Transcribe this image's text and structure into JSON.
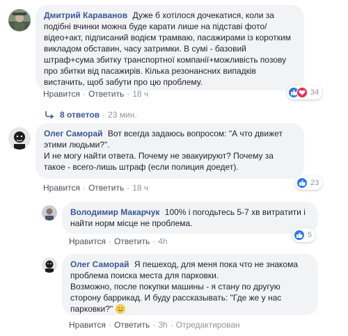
{
  "comments": [
    {
      "author": "Дмитрий Караванов",
      "text": "Дуже б хотілося дочекатися, коли за подібні вчинки можна буде карати лише на підставі фото/відео+акт, підписаний водієм трамваю, пасажирами із коротким викладом обставин, часу затримки. В сумі - базовий штраф+сума збитку транспортної компанії+можливість позову про збитки від пасажирів. Кілька резонансних випадків вистачить, щоб забути про цю проблему.",
      "like_label": "Нравится",
      "reply_label": "Ответить",
      "time": "18 ч",
      "reaction_count": "34",
      "replies_label": "8 ответов",
      "replies_time": "23 мин."
    },
    {
      "author": "Олег Саморай",
      "text1": "Вот всегда задаюсь вопросом: \"А что движет этими людьми?\".",
      "text2": "И не могу найти ответа. Почему не эвакуируют? Почему за такое - всего-лишь штраф (если полиция доедет).",
      "like_label": "Нравится",
      "reply_label": "Ответить",
      "time": "18 ч",
      "reaction_count": "23"
    },
    {
      "author": "Володимир Макарчук",
      "text": "100% і погодьтесь 5-7 хв витратити і найти норм місце не проблема.",
      "like_label": "Нравится",
      "reply_label": "Ответить",
      "time": "4h",
      "reaction_count": "5"
    },
    {
      "author": "Олег Саморай",
      "text1": "Я пешеход, для меня пока что не знакома проблема поиска места для парковки.",
      "text2": "Возможно, после покупки машины - я стану по другую сторону баррикад. И буду рассказывать: \"Где же у нас парковки?\"",
      "like_label": "Нравится",
      "reply_label": "Ответить",
      "time": "3h",
      "edited_label": "Отредактирован"
    }
  ],
  "colors": {
    "link": "#385898",
    "bubble": "#f2f3f5",
    "meta": "#90949c",
    "like": "#2a77f2",
    "love": "#f0284a"
  }
}
